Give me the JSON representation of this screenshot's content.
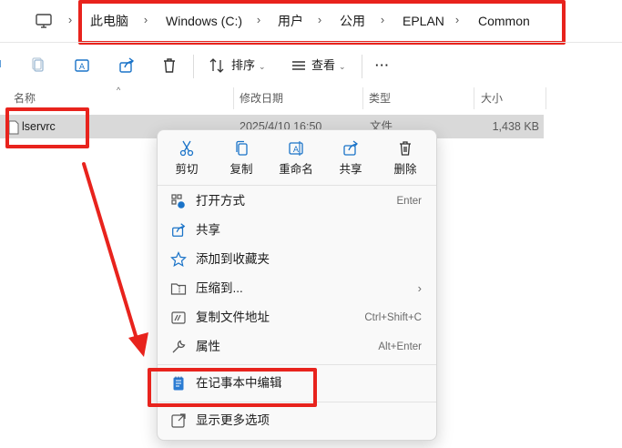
{
  "breadcrumb": {
    "items": [
      "此电脑",
      "Windows (C:)",
      "用户",
      "公用",
      "EPLAN",
      "Common"
    ]
  },
  "toolbar": {
    "sort_label": "排序",
    "view_label": "查看",
    "more_label": "···"
  },
  "columns": {
    "name": "名称",
    "modified": "修改日期",
    "type": "类型",
    "size": "大小"
  },
  "files": [
    {
      "name": "lservrc",
      "modified": "2025/4/10 16:50",
      "type": "文件",
      "size": "1,438 KB"
    }
  ],
  "context_menu": {
    "quick_actions": [
      {
        "label": "剪切",
        "icon": "scissors-icon"
      },
      {
        "label": "复制",
        "icon": "copy-icon"
      },
      {
        "label": "重命名",
        "icon": "rename-icon"
      },
      {
        "label": "共享",
        "icon": "share-icon"
      },
      {
        "label": "删除",
        "icon": "trash-icon"
      }
    ],
    "items": [
      {
        "label": "打开方式",
        "shortcut": "Enter",
        "icon": "open-with-icon"
      },
      {
        "label": "共享",
        "shortcut": "",
        "icon": "share-icon"
      },
      {
        "label": "添加到收藏夹",
        "shortcut": "",
        "icon": "star-icon"
      },
      {
        "label": "压缩到...",
        "shortcut": "",
        "submenu": "›",
        "icon": "zip-folder-icon"
      },
      {
        "label": "复制文件地址",
        "shortcut": "Ctrl+Shift+C",
        "icon": "copy-path-icon"
      },
      {
        "label": "属性",
        "shortcut": "Alt+Enter",
        "icon": "wrench-icon"
      },
      {
        "label": "在记事本中编辑",
        "shortcut": "",
        "icon": "notepad-icon"
      },
      {
        "label": "显示更多选项",
        "shortcut": "",
        "icon": "external-icon"
      }
    ]
  },
  "colors": {
    "annotation_red": "#e8231d",
    "accent_blue": "#1a73c8",
    "selected_row": "#d9d9d9"
  }
}
